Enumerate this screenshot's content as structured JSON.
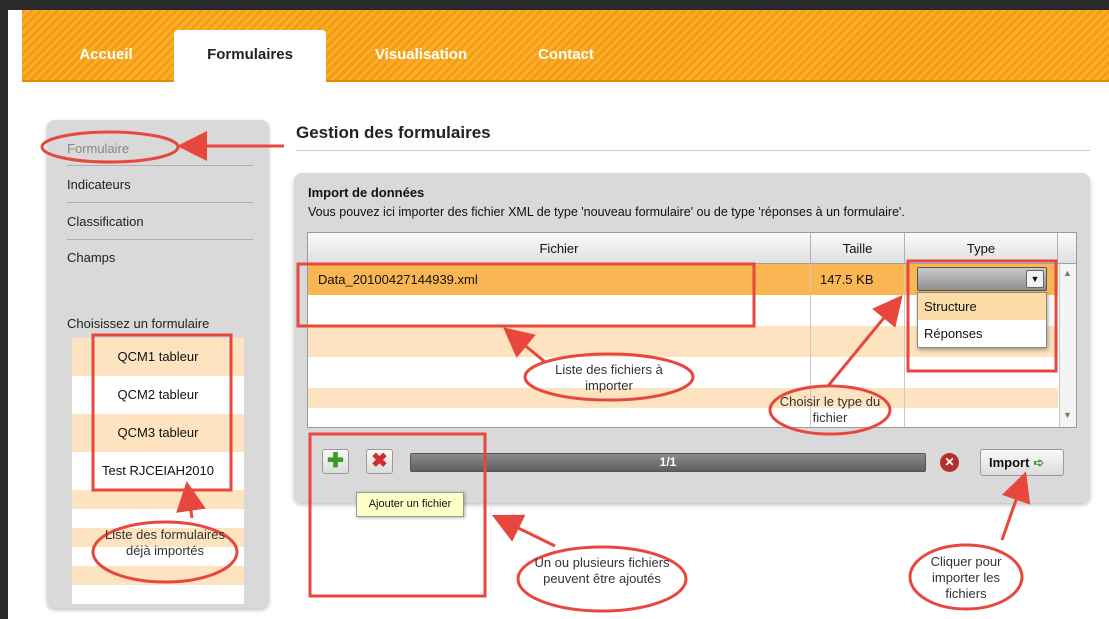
{
  "nav": {
    "items": [
      {
        "label": "Accueil"
      },
      {
        "label": "Formulaires"
      },
      {
        "label": "Visualisation"
      },
      {
        "label": "Contact"
      }
    ]
  },
  "sidebar": {
    "links": [
      {
        "label": "Formulaire"
      },
      {
        "label": "Indicateurs"
      },
      {
        "label": "Classification"
      },
      {
        "label": "Champs"
      }
    ],
    "chooser_label": "Choisissez un formulaire",
    "forms": [
      "QCM1 tableur",
      "QCM2 tableur",
      "QCM3 tableur",
      "Test RJCEIAH2010"
    ]
  },
  "page": {
    "title": "Gestion des formulaires"
  },
  "import_panel": {
    "title": "Import de données",
    "description": "Vous pouvez ici importer des fichier XML de type 'nouveau formulaire' ou de type 'réponses à un formulaire'.",
    "columns": {
      "file": "Fichier",
      "size": "Taille",
      "type": "Type"
    },
    "rows": [
      {
        "file": "Data_20100427144939.xml",
        "size": "147.5 KB",
        "type": ""
      }
    ],
    "type_options": [
      "Structure",
      "Réponses"
    ],
    "progress_text": "1/1",
    "import_label": "Import",
    "add_tooltip": "Ajouter un fichier"
  },
  "annotations": {
    "file_list": "Liste des fichiers à importer",
    "choose_type": "Choisir le type du fichier",
    "forms_list": "Liste des formulaires déjà importés",
    "add_files": "Un ou plusieurs fichiers peuvent être ajoutés",
    "click_import": "Cliquer pour importer les fichiers"
  },
  "colors": {
    "accent_orange": "#f59c12",
    "selected_row": "#f9b652",
    "row_stripe": "#fde3c0",
    "annotation_red": "#e8473e"
  }
}
